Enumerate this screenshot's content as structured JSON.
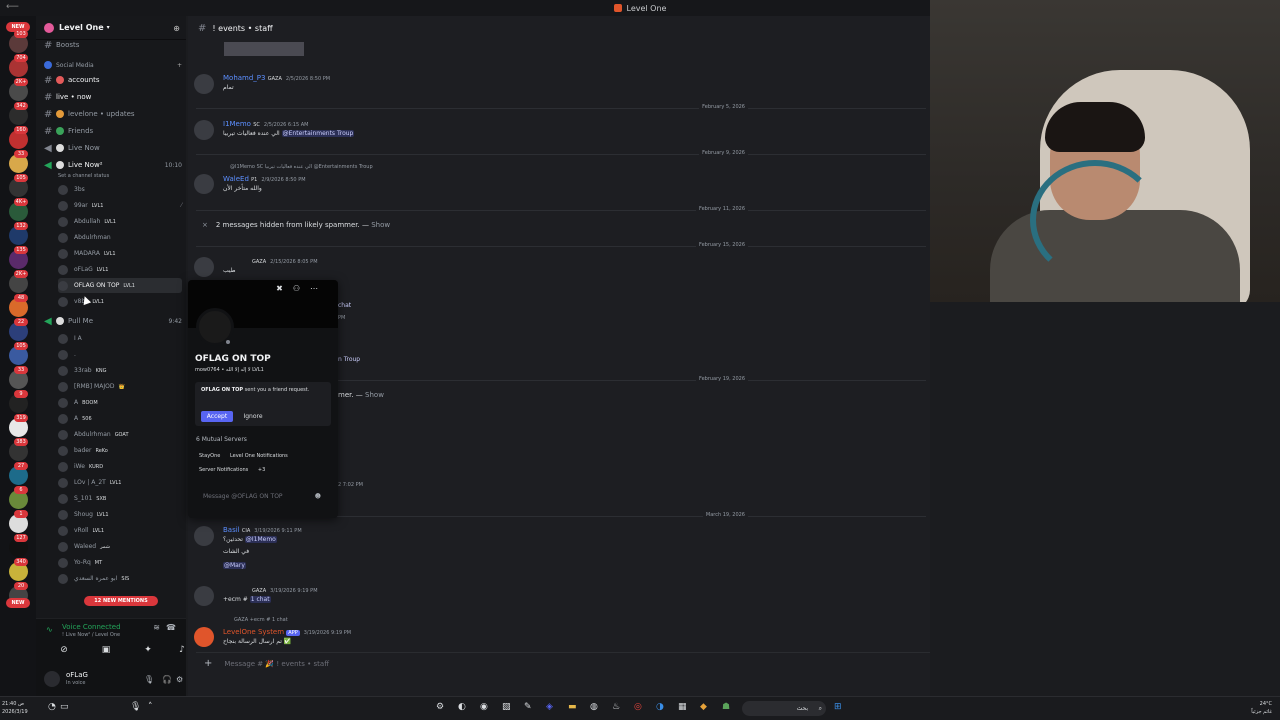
{
  "window": {
    "title": "Level One",
    "back_icon": "arrow-back-icon"
  },
  "rail": {
    "badges": [
      "NEW",
      "103",
      "704",
      "2K+",
      "342",
      "160",
      "33",
      "105",
      "4K+",
      "132",
      "135",
      "2K+",
      "48",
      "22",
      "105",
      "33",
      "9",
      "319",
      "383",
      "27",
      "6",
      "1",
      "127",
      "340",
      "20",
      "18",
      "3K+",
      "NEW"
    ],
    "colors": {
      "badge": "#da373c"
    }
  },
  "guild": {
    "name": "Level One",
    "channels": [
      {
        "name": "Boosts"
      },
      {
        "name": "Social Media",
        "is_category": true
      },
      {
        "name": "accounts"
      },
      {
        "name": "live • now"
      },
      {
        "name": "levelone • updates"
      },
      {
        "name": "Friends"
      },
      {
        "name": "Live Now"
      },
      {
        "name": "Live Now²",
        "time": "10:10",
        "status": "Set a channel status"
      }
    ],
    "voice_members_1": [
      {
        "name": "3bs",
        "tag": ""
      },
      {
        "name": "99ar",
        "tag": "LVL1"
      },
      {
        "name": "Abdullah",
        "tag": "LVL1"
      },
      {
        "name": "Abdulrhman",
        "tag": ""
      },
      {
        "name": "MADARA",
        "tag": "LVL1"
      },
      {
        "name": "oFLaG",
        "tag": "LVL1"
      },
      {
        "name": "OFLAG ON TOP",
        "tag": "LVL1"
      },
      {
        "name": "v8bs",
        "tag": "LVL1"
      }
    ],
    "pull_me": {
      "name": "Pull Me",
      "time": "9:42"
    },
    "voice_members_2": [
      {
        "name": "I A",
        "tag": ""
      },
      {
        "name": ".",
        "tag": ""
      },
      {
        "name": "33rab",
        "tag": "KNG"
      },
      {
        "name": "[RMB] MAJOD",
        "tag": "👑"
      },
      {
        "name": "A",
        "tag": "BOOM"
      },
      {
        "name": "A",
        "tag": "506"
      },
      {
        "name": "Abdulrhman",
        "tag": "GOAT"
      },
      {
        "name": "bader",
        "tag": "ReKo"
      },
      {
        "name": "iWe",
        "tag": "KURD"
      },
      {
        "name": "LOv | A_2T",
        "tag": "LVL1"
      },
      {
        "name": "S_101",
        "tag": "SXB"
      },
      {
        "name": "Shoug",
        "tag": "LVL1"
      },
      {
        "name": "vRoll",
        "tag": "LVL1"
      },
      {
        "name": "Waleed",
        "tag": "شمر"
      },
      {
        "name": "Yo-Rq",
        "tag": "MT"
      },
      {
        "name": "ابو عمره السعدي",
        "tag": "SIS"
      }
    ],
    "mentions_label": "12 NEW MENTIONS"
  },
  "voice": {
    "status": "Voice Connected",
    "location": "! Live Now² / Level One"
  },
  "user": {
    "name": "oFLaG",
    "status": "In voice"
  },
  "chat": {
    "channel": "! events • staff",
    "messages": [
      {
        "author": "Mohamd_P3",
        "tag": "GAZA",
        "time": "2/5/2026 8:50 PM",
        "text": "تمام"
      },
      {
        "author": "I1Memo",
        "tag": "SC",
        "time": "2/5/2026 6:15 AM",
        "text": "الي عنده فعاليات تيربيا",
        "mention": "@Entertainments Troup"
      },
      {
        "author": "WaleEd",
        "tag": "P1",
        "time": "2/9/2026 8:50 PM",
        "text": "والله متأخر الأن",
        "reply": "@I1Memo  SC الي عنده فعاليات تيربيا @Entertainments Troup"
      },
      {
        "author": "",
        "tag": "GAZA",
        "time": "2/15/2026 8:05 PM",
        "text": "طيب"
      },
      {
        "author": "Basil",
        "tag": "CIA",
        "time": "3/19/2026 9:11 PM",
        "text": "تحدثين؟",
        "mention": "@I1Memo",
        "text2": "في الشات",
        "extra": "@Mary"
      },
      {
        "author": "",
        "tag": "GAZA",
        "time": "3/19/2026 9:19 PM",
        "text": "+ecm #",
        "mention": "1 chat"
      },
      {
        "author": "LevelOne System",
        "tag": "APP",
        "time": "3/19/2026 9:19 PM",
        "text": "تم ارسال الرسالة بنجاح",
        "reply": "GAZA +ecm # 1 chat"
      }
    ],
    "dates": [
      "February 5, 2026",
      "February 9, 2026",
      "February 11, 2026",
      "February 15, 2026",
      "February 19, 2026",
      "March 19, 2026"
    ],
    "hidden_note": "2 messages hidden from likely spammer. —",
    "hidden_show": "Show",
    "hidden_note2": "mer. —",
    "composer_placeholder": "Message # 🎉 ! events • staff",
    "fragments": {
      "chat": "chat",
      "pm": "PM",
      "troup": "n Troup",
      "pm2": "2 7:02 PM"
    }
  },
  "profile_popup": {
    "name": "OFLAG ON TOP",
    "username": "mow0764 • لا إله إلا الله",
    "tag": "LVL1",
    "request_name": "OFLAG ON TOP",
    "request_text": "sent you a friend request.",
    "accept": "Accept",
    "ignore": "Ignore",
    "mutual": "6 Mutual Servers",
    "servers": [
      "StayOne",
      "Level One Notifications",
      "Server Notifications",
      "+3"
    ],
    "message_placeholder": "Message @OFLAG ON TOP"
  },
  "taskbar": {
    "search": "بحث",
    "time": "21:40 ص",
    "date": "2026/3/19",
    "weather": "24°C",
    "weather_sub": "غائم جزئياً"
  }
}
